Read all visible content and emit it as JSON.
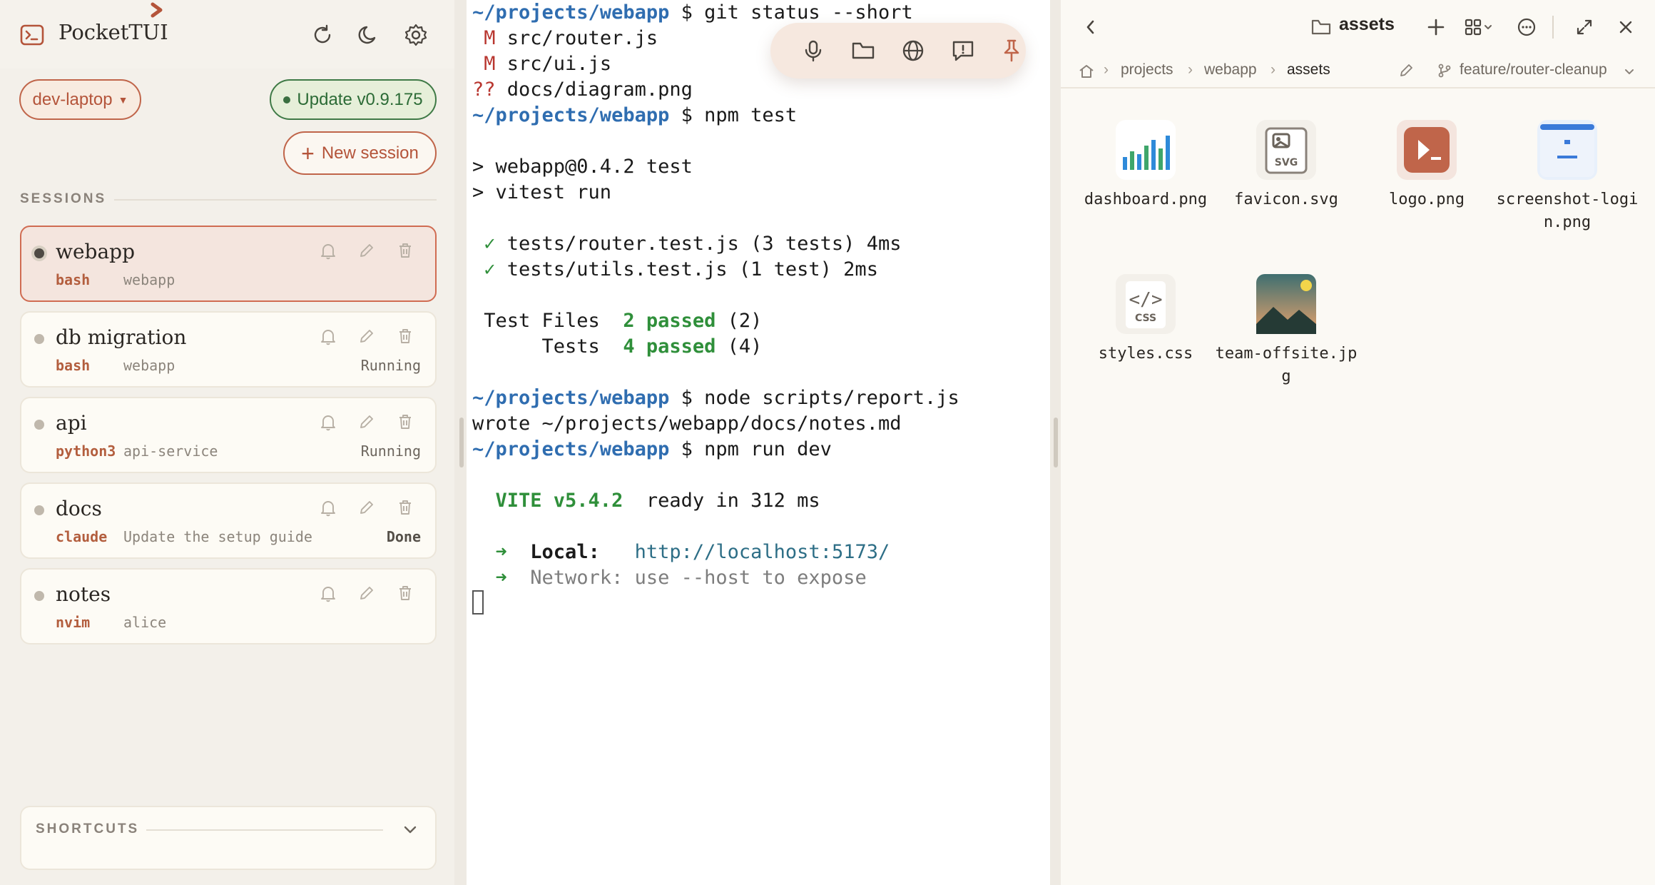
{
  "app": {
    "title": "PocketTUI",
    "icons": [
      "terminal-icon",
      "refresh-icon",
      "moon-icon",
      "gear-icon"
    ]
  },
  "device": {
    "label": "dev-laptop",
    "caret": "▼"
  },
  "update": {
    "label": "Update v0.9.175"
  },
  "new_session": {
    "plus": "+",
    "label": "New session"
  },
  "sessions_label": "SESSIONS",
  "sessions": [
    {
      "name": "webapp",
      "cmd": "bash",
      "sub": "webapp",
      "status": "",
      "active": true
    },
    {
      "name": "db migration",
      "cmd": "bash",
      "sub": "webapp",
      "status": "Running"
    },
    {
      "name": "api",
      "cmd": "python3",
      "sub": "api-service",
      "status": "Running"
    },
    {
      "name": "docs",
      "cmd": "claude",
      "sub": "Update the setup guide",
      "status": "Done"
    },
    {
      "name": "notes",
      "cmd": "nvim",
      "sub": "alice",
      "status": ""
    }
  ],
  "shortcuts": {
    "label": "SHORTCUTS"
  },
  "terminal": {
    "lines": [
      [
        [
          "c-path",
          "~/projects/webapp"
        ],
        [
          "",
          " $ git status --short"
        ]
      ],
      [
        [
          "c-red",
          " M"
        ],
        [
          "",
          " src/router.js"
        ]
      ],
      [
        [
          "c-red",
          " M"
        ],
        [
          "",
          " src/ui.js"
        ]
      ],
      [
        [
          "c-red",
          "??"
        ],
        [
          "",
          " docs/diagram.png"
        ]
      ],
      [
        [
          "c-path",
          "~/projects/webapp"
        ],
        [
          "",
          " $ npm test"
        ]
      ],
      [],
      [
        [
          "",
          "> webapp@0.4.2 test"
        ]
      ],
      [
        [
          "",
          "> vitest run"
        ]
      ],
      [],
      [
        [
          "c-green",
          " ✓"
        ],
        [
          "",
          " tests/router.test.js (3 tests) 4ms"
        ]
      ],
      [
        [
          "c-green",
          " ✓"
        ],
        [
          "",
          " tests/utils.test.js (1 test) 2ms"
        ]
      ],
      [],
      [
        [
          "",
          " Test Files  "
        ],
        [
          "c-bgreen",
          "2 passed"
        ],
        [
          "",
          " (2)"
        ]
      ],
      [
        [
          "",
          "      Tests  "
        ],
        [
          "c-bgreen",
          "4 passed"
        ],
        [
          "",
          " (4)"
        ]
      ],
      [],
      [
        [
          "c-path",
          "~/projects/webapp"
        ],
        [
          "",
          " $ node scripts/report.js"
        ]
      ],
      [
        [
          "",
          "wrote ~/projects/webapp/docs/notes.md"
        ]
      ],
      [
        [
          "c-path",
          "~/projects/webapp"
        ],
        [
          "",
          " $ npm run dev"
        ]
      ],
      [],
      [
        [
          "c-bgreen",
          "  VITE v5.4.2"
        ],
        [
          "",
          "  ready in 312 ms"
        ]
      ],
      [],
      [
        [
          "c-green",
          "  ➜"
        ],
        [
          "c-bold",
          "  Local:"
        ],
        [
          "",
          "   "
        ],
        [
          "c-url",
          "http://localhost:5173/"
        ]
      ],
      [
        [
          "c-green",
          "  ➜"
        ],
        [
          "c-gray",
          "  Network: use --host to expose"
        ]
      ]
    ],
    "toolbar_icons": [
      "mic-icon",
      "folder-icon",
      "globe-icon",
      "feedback-icon",
      "pin-icon"
    ]
  },
  "files": {
    "title": "assets",
    "breadcrumbs": [
      "projects",
      "webapp",
      "assets"
    ],
    "branch": "feature/router-cleanup",
    "items": [
      {
        "name": "dashboard.png",
        "icon": "chart-icon"
      },
      {
        "name": "favicon.svg",
        "icon": "svg-file-icon"
      },
      {
        "name": "logo.png",
        "icon": "terminal-logo-icon"
      },
      {
        "name": "screenshot-login.png",
        "icon": "screenshot-icon"
      },
      {
        "name": "styles.css",
        "icon": "css-file-icon"
      },
      {
        "name": "team-offsite.jpg",
        "icon": "landscape-photo-icon"
      }
    ]
  },
  "colors": {
    "accent": "#c0654a",
    "update_green": "#3f7a46",
    "prompt_path": "#2f6db0",
    "pass_green": "#2f8f3a",
    "git_modified": "#b8362f"
  }
}
